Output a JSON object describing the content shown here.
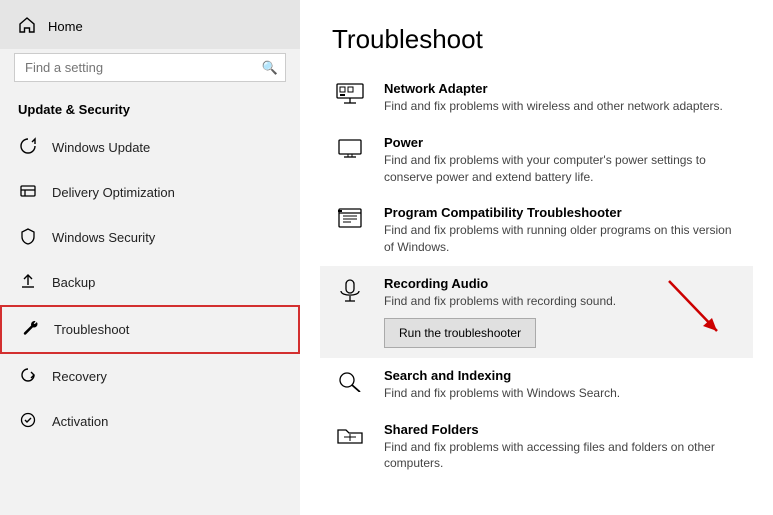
{
  "sidebar": {
    "home_label": "Home",
    "search_placeholder": "Find a setting",
    "section_title": "Update & Security",
    "items": [
      {
        "id": "windows-update",
        "label": "Windows Update",
        "icon": "update"
      },
      {
        "id": "delivery-optimization",
        "label": "Delivery Optimization",
        "icon": "delivery"
      },
      {
        "id": "windows-security",
        "label": "Windows Security",
        "icon": "shield"
      },
      {
        "id": "backup",
        "label": "Backup",
        "icon": "backup"
      },
      {
        "id": "troubleshoot",
        "label": "Troubleshoot",
        "icon": "wrench",
        "active": true
      },
      {
        "id": "recovery",
        "label": "Recovery",
        "icon": "recovery"
      },
      {
        "id": "activation",
        "label": "Activation",
        "icon": "activation"
      }
    ]
  },
  "main": {
    "title": "Troubleshoot",
    "items": [
      {
        "id": "network-adapter",
        "title": "Network Adapter",
        "desc": "Find and fix problems with wireless and other network adapters.",
        "icon": "network"
      },
      {
        "id": "power",
        "title": "Power",
        "desc": "Find and fix problems with your computer's power settings to conserve power and extend battery life.",
        "icon": "power"
      },
      {
        "id": "program-compatibility",
        "title": "Program Compatibility Troubleshooter",
        "desc": "Find and fix problems with running older programs on this version of Windows.",
        "icon": "program"
      },
      {
        "id": "recording-audio",
        "title": "Recording Audio",
        "desc": "Find and fix problems with recording sound.",
        "icon": "mic",
        "highlighted": true,
        "button_label": "Run the troubleshooter"
      },
      {
        "id": "search-indexing",
        "title": "Search and Indexing",
        "desc": "Find and fix problems with Windows Search.",
        "icon": "search"
      },
      {
        "id": "shared-folders",
        "title": "Shared Folders",
        "desc": "Find and fix problems with accessing files and folders on other computers.",
        "icon": "folder"
      }
    ]
  }
}
